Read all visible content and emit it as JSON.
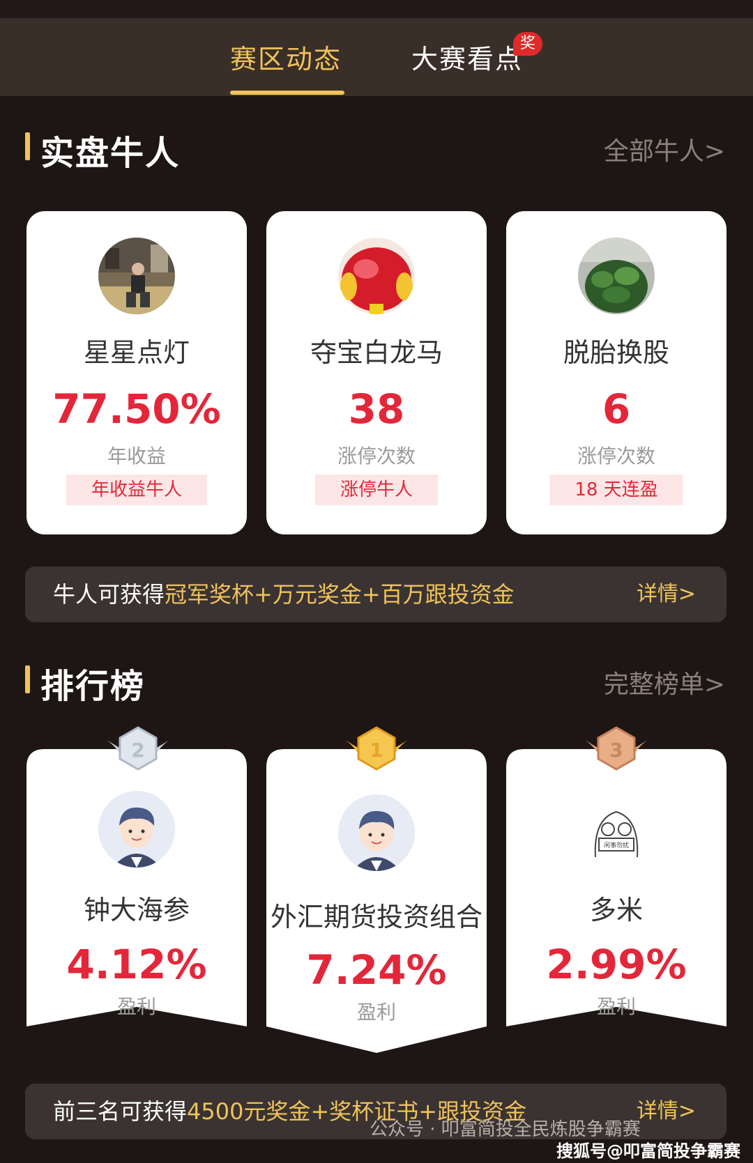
{
  "tabs": [
    {
      "label": "赛区动态",
      "active": true
    },
    {
      "label": "大赛看点",
      "active": false
    }
  ],
  "tab_badge": "奖",
  "section1": {
    "title": "实盘牛人",
    "link": "全部牛人>"
  },
  "niuren_cards": [
    {
      "name": "星星点灯",
      "value": "77.50%",
      "label": "年收益",
      "tag": "年收益牛人",
      "avatar": "person-photo"
    },
    {
      "name": "夺宝白龙马",
      "value": "38",
      "label": "涨停次数",
      "tag": "涨停牛人",
      "avatar": "red-fruit-photo"
    },
    {
      "name": "脱胎换股",
      "value": "6",
      "label": "涨停次数",
      "tag": "18 天连盈",
      "avatar": "green-plant-photo"
    }
  ],
  "banner1": {
    "prefix": "牛人可获得",
    "highlight": "冠军奖杯+万元奖金+百万跟投资金",
    "link": "详情>"
  },
  "section2": {
    "title": "排行榜",
    "link": "完整榜单>"
  },
  "rank_cards": [
    {
      "rank": "2",
      "name": "钟大海参",
      "value": "4.12%",
      "label": "盈利",
      "medal": "silver-medal"
    },
    {
      "rank": "1",
      "name": "外汇期货投资组合",
      "value": "7.24%",
      "label": "盈利",
      "medal": "gold-medal"
    },
    {
      "rank": "3",
      "name": "多米",
      "value": "2.99%",
      "label": "盈利",
      "medal": "bronze-medal"
    }
  ],
  "banner2": {
    "prefix": "前三名可获得",
    "highlight": "4500元奖金+奖杯证书+跟投资金",
    "link": "详情>"
  },
  "watermark": {
    "left": "公众号 · 叩富简投全民炼股争霸赛",
    "right": "搜狐号@叩富简投争霸赛"
  },
  "colors": {
    "accent_gold": "#f0c35a",
    "value_red": "#e3273a",
    "bg_dark": "#1e1615"
  }
}
